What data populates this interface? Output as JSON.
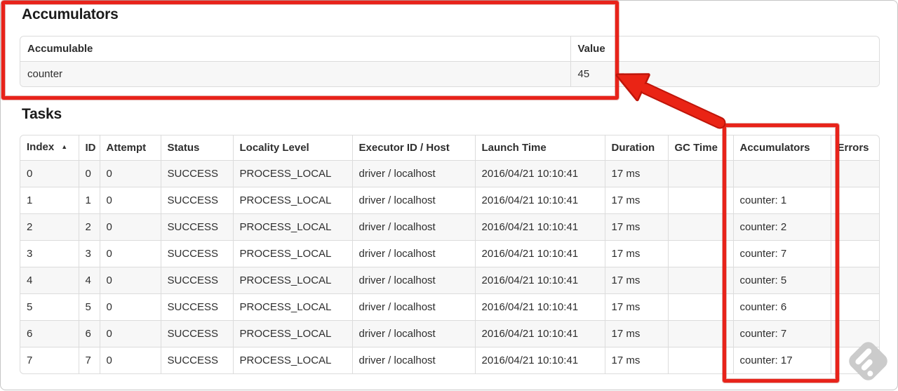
{
  "annotations": {
    "color": "#e8231a",
    "arrow_fill": "#ea2415",
    "arrow_outline": "#bf150a"
  },
  "accumulators_section": {
    "title": "Accumulators",
    "table": {
      "headers": {
        "accumulable": "Accumulable",
        "value": "Value"
      },
      "row": {
        "accumulable": "counter",
        "value": "45"
      }
    }
  },
  "tasks_section": {
    "title": "Tasks",
    "table": {
      "headers": [
        "Index",
        "ID",
        "Attempt",
        "Status",
        "Locality Level",
        "Executor ID / Host",
        "Launch Time",
        "Duration",
        "GC Time",
        "Accumulators",
        "Errors"
      ],
      "sort_indicator": "▲",
      "rows": [
        [
          "0",
          "0",
          "0",
          "SUCCESS",
          "PROCESS_LOCAL",
          "driver / localhost",
          "2016/04/21 10:10:41",
          "17 ms",
          "",
          "",
          ""
        ],
        [
          "1",
          "1",
          "0",
          "SUCCESS",
          "PROCESS_LOCAL",
          "driver / localhost",
          "2016/04/21 10:10:41",
          "17 ms",
          "",
          "counter: 1",
          ""
        ],
        [
          "2",
          "2",
          "0",
          "SUCCESS",
          "PROCESS_LOCAL",
          "driver / localhost",
          "2016/04/21 10:10:41",
          "17 ms",
          "",
          "counter: 2",
          ""
        ],
        [
          "3",
          "3",
          "0",
          "SUCCESS",
          "PROCESS_LOCAL",
          "driver / localhost",
          "2016/04/21 10:10:41",
          "17 ms",
          "",
          "counter: 7",
          ""
        ],
        [
          "4",
          "4",
          "0",
          "SUCCESS",
          "PROCESS_LOCAL",
          "driver / localhost",
          "2016/04/21 10:10:41",
          "17 ms",
          "",
          "counter: 5",
          ""
        ],
        [
          "5",
          "5",
          "0",
          "SUCCESS",
          "PROCESS_LOCAL",
          "driver / localhost",
          "2016/04/21 10:10:41",
          "17 ms",
          "",
          "counter: 6",
          ""
        ],
        [
          "6",
          "6",
          "0",
          "SUCCESS",
          "PROCESS_LOCAL",
          "driver / localhost",
          "2016/04/21 10:10:41",
          "17 ms",
          "",
          "counter: 7",
          ""
        ],
        [
          "7",
          "7",
          "0",
          "SUCCESS",
          "PROCESS_LOCAL",
          "driver / localhost",
          "2016/04/21 10:10:41",
          "17 ms",
          "",
          "counter: 17",
          ""
        ]
      ]
    }
  },
  "watermark": {
    "icon": "skitch-diamond-watermark"
  }
}
